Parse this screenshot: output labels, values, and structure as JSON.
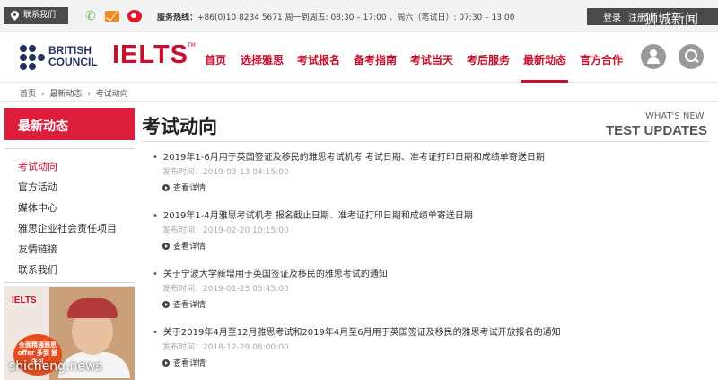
{
  "topbar": {
    "contact_label": "联系我们",
    "hotline_label": "服务热线：",
    "hotline_text": "+86(0)10 8234 5671 周一到周五: 08:30 – 17:00 、周六（笔试日）: 07:30 – 13:00",
    "login_label": "登录",
    "register_label": "注册",
    "watermark": "狮城新闻"
  },
  "brand": {
    "bc_line1": "BRITISH",
    "bc_line2": "COUNCIL",
    "ielts": "IELTS",
    "tm": "TM"
  },
  "nav": {
    "items": [
      "首页",
      "选择雅思",
      "考试报名",
      "备考指南",
      "考试当天",
      "考后服务",
      "最新动态",
      "官方合作"
    ],
    "active": "最新动态"
  },
  "breadcrumb": [
    "首页",
    "›",
    "最新动态",
    "›",
    "考试动向"
  ],
  "sidebar": {
    "title": "最新动态",
    "items": [
      "考试动向",
      "官方活动",
      "媒体中心",
      "雅思企业社会责任项目",
      "友情链接",
      "联系我们"
    ],
    "active": "考试动向",
    "promo_ielts": "IELTS",
    "promo_badge": "全面精通雅思 offer 多到 触手可"
  },
  "main": {
    "title": "考试动向",
    "whats_new": "WHAT'S NEW",
    "test_updates": "TEST UPDATES",
    "date_label": "发布时间：",
    "more_label": "查看详情",
    "articles": [
      {
        "title": "2019年1-6月用于英国签证及移民的雅思考试机考 考试日期、准考证打印日期和成绩单寄送日期",
        "date": "发布时间：2019-03-13 04:15:00",
        "more": "查看详情"
      },
      {
        "title": "2019年1-4月雅思考试机考 报名截止日期、准考证打印日期和成绩单寄送日期",
        "date": "发布时间：2019-02-20 10:15:00",
        "more": "查看详情"
      },
      {
        "title": "关于宁波大学新增用于英国签证及移民的雅思考试的通知",
        "date": "发布时间：2019-01-23 05:45:00",
        "more": "查看详情"
      },
      {
        "title": "关于2019年4月至12月雅思考试和2019年4月至6月用于英国签证及移民的雅思考试开放报名的通知",
        "date": "发布时间：2018-12-29 06:00:00",
        "more": "查看详情"
      }
    ]
  },
  "watermark_bottom": "shicheng.news",
  "colors": {
    "brand_red": "#c8102e",
    "sidebar_red": "#dc1e3c",
    "navy": "#23335e",
    "dark_bar": "#4a4a4a"
  }
}
